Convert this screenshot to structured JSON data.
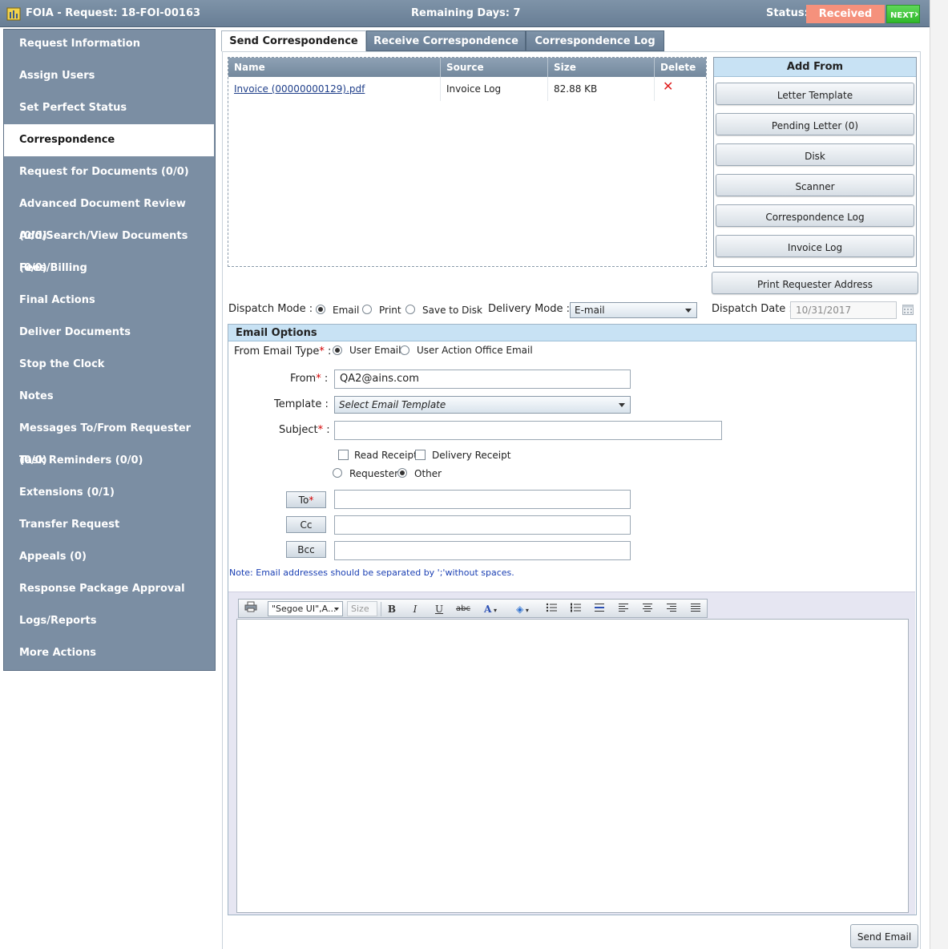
{
  "header": {
    "app_title": "FOIA - Request: 18-FOI-00163",
    "remaining": "Remaining Days: 7",
    "status_label": "Status:",
    "status_value": "Received",
    "next_label": "NEXT"
  },
  "sidebar": {
    "items": [
      {
        "label": "Request Information"
      },
      {
        "label": "Assign Users"
      },
      {
        "label": "Set Perfect Status"
      },
      {
        "label": "Correspondence"
      },
      {
        "label": "Request for Documents (0/0)"
      },
      {
        "label": "Advanced Document Review (0/0)"
      },
      {
        "label": "Add/Search/View Documents (0/0)"
      },
      {
        "label": "Fees/Billing"
      },
      {
        "label": "Final Actions"
      },
      {
        "label": "Deliver Documents"
      },
      {
        "label": "Stop the Clock"
      },
      {
        "label": "Notes"
      },
      {
        "label": "Messages To/From Requester (0/0)"
      },
      {
        "label": "Task Reminders (0/0)"
      },
      {
        "label": "Extensions (0/1)"
      },
      {
        "label": "Transfer Request"
      },
      {
        "label": "Appeals (0)"
      },
      {
        "label": "Response Package Approval"
      },
      {
        "label": "Logs/Reports"
      },
      {
        "label": "More Actions"
      }
    ],
    "active_index": 3
  },
  "tabs": [
    {
      "label": "Send Correspondence"
    },
    {
      "label": "Receive Correspondence"
    },
    {
      "label": "Correspondence Log"
    }
  ],
  "grid": {
    "columns": [
      "Name",
      "Source",
      "Size",
      "Delete"
    ],
    "rows": [
      {
        "name": "Invoice (00000000129).pdf",
        "source": "Invoice Log",
        "size": "82.88 KB",
        "delete": "✕"
      }
    ]
  },
  "add_from": {
    "title": "Add From",
    "buttons": [
      "Letter Template",
      "Pending Letter (0)",
      "Disk",
      "Scanner",
      "Correspondence Log",
      "Invoice Log"
    ]
  },
  "print_requester_address": "Print Requester Address",
  "dispatch": {
    "mode_label": "Dispatch Mode :",
    "options": [
      "Email",
      "Print",
      "Save to Disk"
    ],
    "selected": "Email",
    "delivery_label": "Delivery Mode :",
    "delivery_value": "E-mail",
    "date_label": "Dispatch Date :",
    "date_value": "10/31/2017"
  },
  "email_options": {
    "title": "Email Options",
    "from_type_label": "From Email Type",
    "from_type_options": [
      "User Email",
      "User Action Office Email"
    ],
    "from_type_selected": "User Email",
    "from_label": "From",
    "from_value": "QA2@ains.com",
    "template_label": "Template :",
    "template_placeholder": "Select Email Template",
    "subject_label": "Subject",
    "subject_value": "",
    "read_receipt": "Read Receipt",
    "delivery_receipt": "Delivery Receipt",
    "recipient_options": [
      "Requester",
      "Other"
    ],
    "recipient_selected": "Other",
    "to_label": "To",
    "cc_label": "Cc",
    "bcc_label": "Bcc",
    "note": "Note: Email addresses should be separated by ';'without spaces.",
    "colon": " :",
    "req_mark": "*"
  },
  "editor": {
    "font_value": "\"Segoe UI\",A...",
    "size_placeholder": "Size",
    "tools": [
      "print-icon",
      "bold-icon",
      "italic-icon",
      "underline-icon",
      "strikethrough-icon",
      "font-color-icon",
      "highlight-icon",
      "bullet-list-icon",
      "numbered-list-icon",
      "line-spacing-icon",
      "align-left-icon",
      "align-center-icon",
      "align-right-icon",
      "justify-icon"
    ]
  },
  "send_email_label": "Send Email",
  "colors": {
    "sidebar": "#7b8ea3",
    "header": "#6f8499",
    "status_badge": "#f5917c",
    "next": "#3ec739",
    "section_head": "#c8e2f4"
  }
}
